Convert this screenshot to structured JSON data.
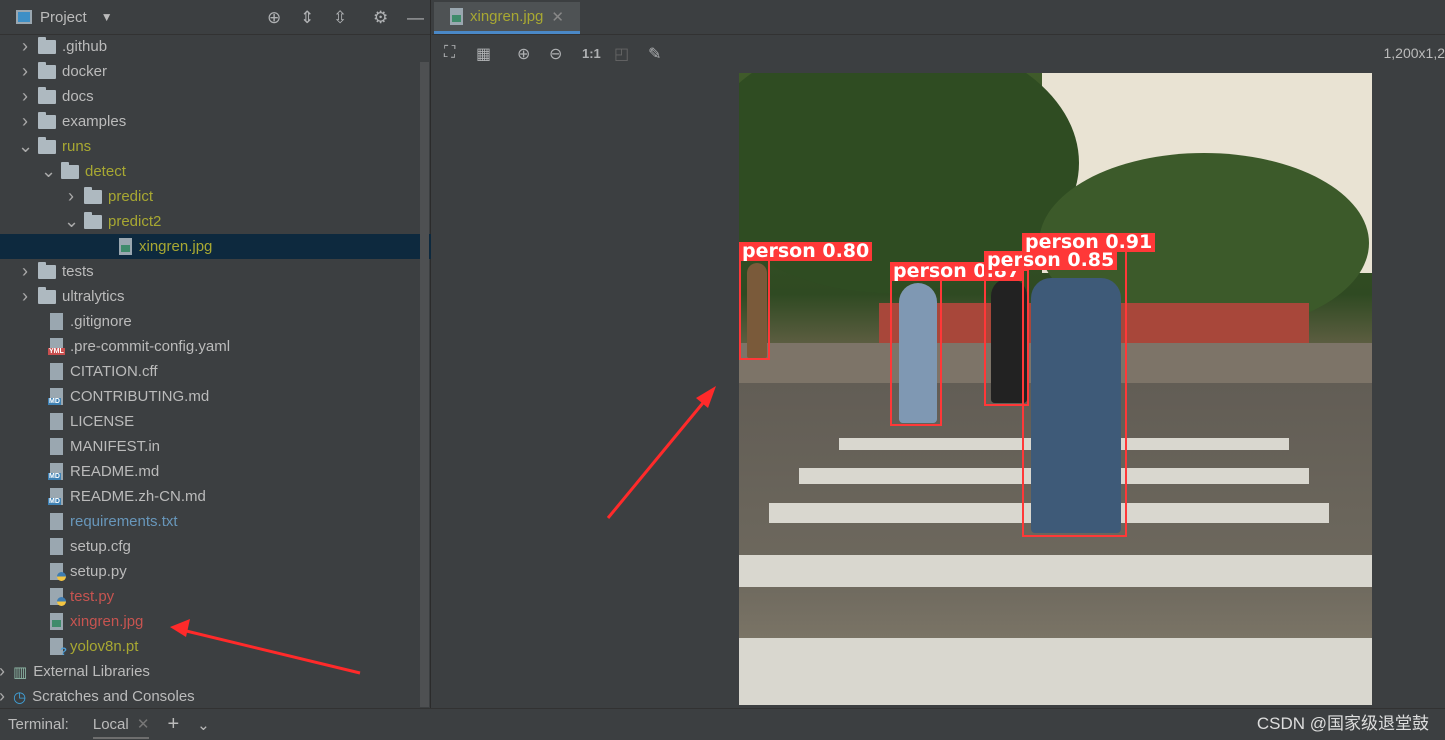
{
  "project_panel": {
    "title": "Project",
    "items": [
      {
        "label": ".github",
        "type": "folder",
        "level": 0,
        "expanded": false
      },
      {
        "label": "docker",
        "type": "folder",
        "level": 0,
        "expanded": false
      },
      {
        "label": "docs",
        "type": "folder",
        "level": 0,
        "expanded": false
      },
      {
        "label": "examples",
        "type": "folder",
        "level": 0,
        "expanded": false
      },
      {
        "label": "runs",
        "type": "folder",
        "level": 0,
        "expanded": true,
        "color": "olive"
      },
      {
        "label": "detect",
        "type": "folder",
        "level": 1,
        "expanded": true,
        "color": "olive"
      },
      {
        "label": "predict",
        "type": "folder",
        "level": 2,
        "expanded": false,
        "color": "olive"
      },
      {
        "label": "predict2",
        "type": "folder",
        "level": 2,
        "expanded": true,
        "color": "olive"
      },
      {
        "label": "xingren.jpg",
        "type": "img",
        "level": 3,
        "color": "olive",
        "selected": true
      },
      {
        "label": "tests",
        "type": "folder",
        "level": 0,
        "expanded": false
      },
      {
        "label": "ultralytics",
        "type": "folder",
        "level": 0,
        "expanded": false
      },
      {
        "label": ".gitignore",
        "type": "file",
        "level": 0
      },
      {
        "label": ".pre-commit-config.yaml",
        "type": "yml",
        "level": 0
      },
      {
        "label": "CITATION.cff",
        "type": "file",
        "level": 0
      },
      {
        "label": "CONTRIBUTING.md",
        "type": "md",
        "level": 0
      },
      {
        "label": "LICENSE",
        "type": "file",
        "level": 0
      },
      {
        "label": "MANIFEST.in",
        "type": "file",
        "level": 0
      },
      {
        "label": "README.md",
        "type": "md",
        "level": 0
      },
      {
        "label": "README.zh-CN.md",
        "type": "md",
        "level": 0
      },
      {
        "label": "requirements.txt",
        "type": "file",
        "level": 0,
        "color": "blue"
      },
      {
        "label": "setup.cfg",
        "type": "file",
        "level": 0
      },
      {
        "label": "setup.py",
        "type": "py",
        "level": 0
      },
      {
        "label": "test.py",
        "type": "py",
        "level": 0,
        "color": "red"
      },
      {
        "label": "xingren.jpg",
        "type": "img",
        "level": 0,
        "color": "red"
      },
      {
        "label": "yolov8n.pt",
        "type": "q",
        "level": 0,
        "color": "olive"
      }
    ],
    "extra": [
      {
        "label": "External Libraries"
      },
      {
        "label": "Scratches and Consoles"
      }
    ]
  },
  "editor": {
    "tab": "xingren.jpg",
    "zoom_label": "1:1",
    "dimensions": "1,200x1,2",
    "detections": [
      {
        "label": "person 0.80"
      },
      {
        "label": "person 0.87"
      },
      {
        "label": "person 0.85"
      },
      {
        "label": "person 0.91"
      }
    ]
  },
  "terminal": {
    "label": "Terminal:",
    "tab": "Local"
  },
  "watermark": "CSDN @国家级退堂鼓",
  "colors": {
    "accent": "#4a88c7",
    "selection": "#0d293e",
    "box": "#ff3838",
    "arrow": "#ff2a2a"
  }
}
